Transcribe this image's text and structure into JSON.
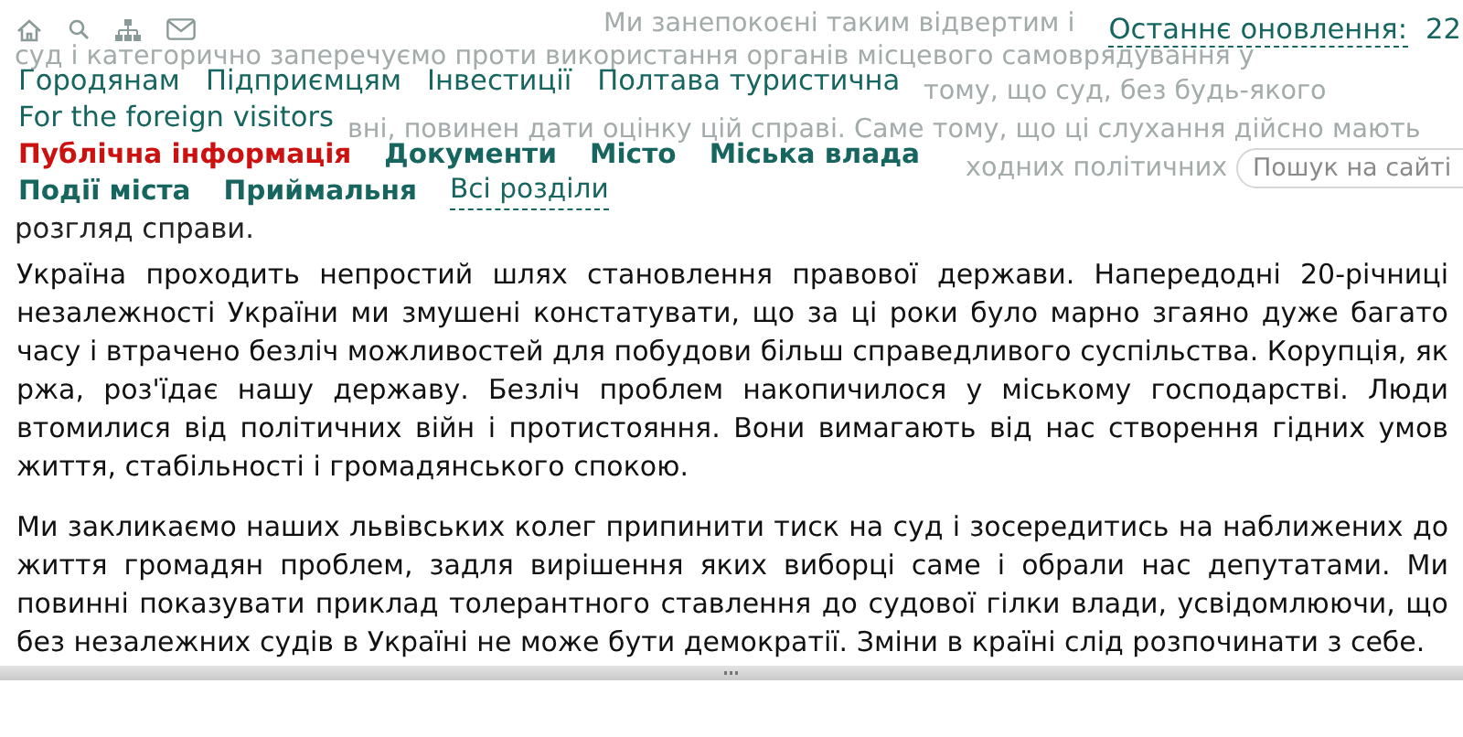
{
  "background_text": [
    "Ми занепокоєні таким відвертим і",
    "суд і категорично заперечуємо проти використання органів місцевого самоврядування у",
    "тому, що суд, без будь-якого",
    "вні, повинен дати оцінку цій справі. Саме тому, що ці слухання дійсно мають",
    "ходних політичних"
  ],
  "article_lead": "розгляд справи.",
  "last_update": {
    "label": "Останнє оновлення:",
    "value": "22"
  },
  "nav_primary": [
    "Городянам",
    "Підприємцям",
    "Інвестиції",
    "Полтава туристична",
    "For the foreign visitors"
  ],
  "nav_secondary": [
    {
      "label": "Публічна інформація",
      "selected": true
    },
    {
      "label": "Документи",
      "selected": false
    },
    {
      "label": "Місто",
      "selected": false
    },
    {
      "label": "Міська влада",
      "selected": false
    },
    {
      "label": "Події міста",
      "selected": false
    },
    {
      "label": "Приймальня",
      "selected": false
    }
  ],
  "all_sections": "Всі розділи",
  "search": {
    "placeholder": "Пошук на сайті"
  },
  "article": {
    "paragraphs": [
      "Україна проходить непростий шлях становлення правової держави. Напередодні 20-річниці незалежності України ми змушені констатувати, що за ці роки було марно згаяно дуже багато часу і втрачено безліч можливостей для побудови більш справедливого суспільства. Корупція, як ржа, роз'їдає нашу державу. Безліч проблем накопичилося у міському господарстві. Люди втомилися від політичних війн і протистояння. Вони вимагають від нас створення гідних умов життя, стабільності і громадянського спокою.",
      "Ми закликаємо наших львівських колег припинити тиск на суд і зосередитись на наближених до життя громадян проблем, задля вирішення яких виборці саме і обрали нас депутатами. Ми повинні показувати приклад толерантного ставлення до судової гілки влади, усвідомлюючи, що без незалежних судів в Україні не може бути демократії. Зміни в країні слід розпочинати з себе."
    ]
  }
}
